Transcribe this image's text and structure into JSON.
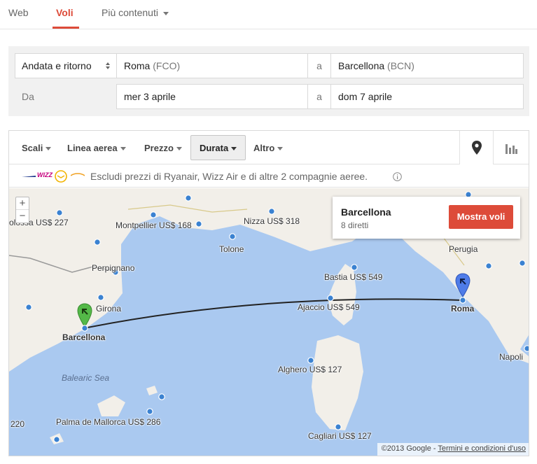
{
  "nav": {
    "tabs": [
      {
        "label": "Web"
      },
      {
        "label": "Voli"
      },
      {
        "label": "Più contenuti"
      }
    ]
  },
  "search": {
    "trip_type": "Andata e ritorno",
    "origin_city": "Roma",
    "origin_code": "(FCO)",
    "to_label": "a",
    "destination_city": "Barcellona",
    "destination_code": "(BCN)",
    "from_date_label": "Da",
    "depart_date": "mer 3 aprile",
    "return_date": "dom 7 aprile"
  },
  "filters": {
    "items": [
      {
        "label": "Scali"
      },
      {
        "label": "Linea aerea"
      },
      {
        "label": "Prezzo"
      },
      {
        "label": "Durata"
      },
      {
        "label": "Altro"
      }
    ],
    "selected": "Durata",
    "view_icons": [
      "map-pin-icon",
      "bar-chart-icon"
    ]
  },
  "exclude": {
    "logo_wizz": "WIZZ",
    "text": "Escludi prezzi di Ryanair, Wizz Air e di altre 2 compagnie aeree."
  },
  "map": {
    "zoom_in": "+",
    "zoom_out": "−",
    "labels": {
      "colossa": "olossa US$ 227",
      "montpellier": "Montpellier US$ 168",
      "nizza": "Nizza US$ 318",
      "tolone": "Tolone",
      "perpignano": "Perpignano",
      "girona": "Girona",
      "barcellona": "Barcellona",
      "bastia": "Bastia US$ 549",
      "ajaccio": "Ajaccio US$ 549",
      "roma": "Roma",
      "perugia": "Perugia",
      "napoli": "Napoli",
      "alghero": "Alghero US$ 127",
      "balearic": "Balearic Sea",
      "palma": "Palma de Mallorca US$ 286",
      "cagliari": "Cagliari US$ 127",
      "edge220": "220"
    },
    "popup": {
      "city": "Barcellona",
      "count": "8 diretti",
      "button": "Mostra voli"
    },
    "footer": {
      "copyright": "©2013 Google - ",
      "terms": "Termini e condizioni d'uso"
    },
    "colors": {
      "sea": "#aac9f0",
      "land": "#f2efe9",
      "origin_pin": "#54b948",
      "dest_pin": "#4f7ce8",
      "accent": "#dd4b39"
    }
  }
}
